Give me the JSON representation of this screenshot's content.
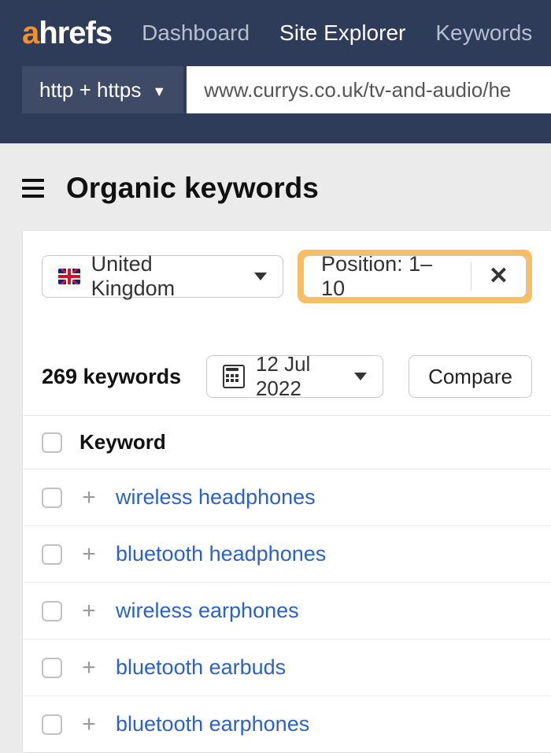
{
  "nav": {
    "logo_a": "a",
    "logo_rest": "hrefs",
    "dashboard": "Dashboard",
    "site_explorer": "Site Explorer",
    "keywords": "Keywords"
  },
  "urlbar": {
    "protocol_label": "http + https",
    "url_value": "www.currys.co.uk/tv-and-audio/he"
  },
  "page": {
    "title": "Organic keywords"
  },
  "filters": {
    "country_label": "United Kingdom",
    "position_label": "Position: 1–10"
  },
  "meta": {
    "count_label": "269 keywords",
    "date_label": "12 Jul 2022",
    "compare_label": "Compare"
  },
  "table": {
    "header_keyword": "Keyword",
    "rows": [
      {
        "keyword": "wireless headphones"
      },
      {
        "keyword": "bluetooth headphones"
      },
      {
        "keyword": "wireless earphones"
      },
      {
        "keyword": "bluetooth earbuds"
      },
      {
        "keyword": "bluetooth earphones"
      }
    ]
  }
}
